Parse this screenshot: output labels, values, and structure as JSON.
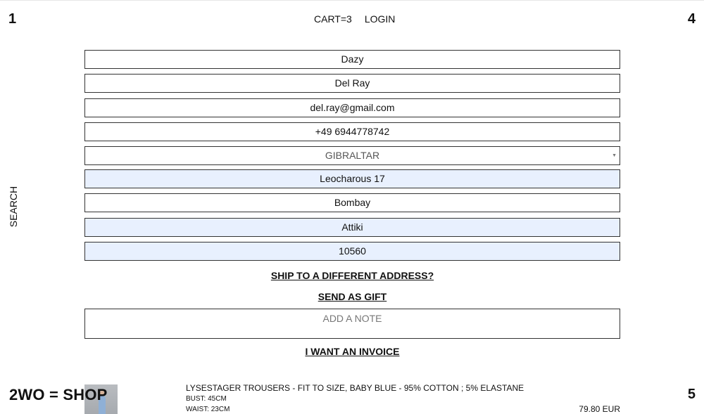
{
  "corners": {
    "top_left": "1",
    "top_right": "4",
    "bottom_right": "5"
  },
  "brand": "2WO = SHOP",
  "nav": {
    "cart": "CART=3",
    "login": "LOGIN",
    "search": "SEARCH"
  },
  "form": {
    "first_name": "Dazy",
    "last_name": "Del Ray",
    "email": "del.ray@gmail.com",
    "phone": "+49 6944778742",
    "country": "GIBRALTAR",
    "address": "Leocharous 17",
    "city": "Bombay",
    "region": "Attiki",
    "postcode": "10560",
    "ship_different": "SHIP TO A DIFFERENT ADDRESS?",
    "send_gift": "SEND AS GIFT ",
    "note_placeholder": "ADD A NOTE",
    "invoice": "I WANT AN INVOICE"
  },
  "cart_item": {
    "title": "LYSESTAGER TROUSERS - FIT TO SIZE, BABY BLUE - 95% COTTON ; 5% ELASTANE",
    "bust": "BUST: 45CM",
    "waist": "WAIST: 23CM",
    "price": "79.80 EUR"
  },
  "colors": {
    "autofill": "#e8f0fe",
    "border": "#333333"
  },
  "icons": {
    "select_arrow": "chevron-down-icon"
  }
}
